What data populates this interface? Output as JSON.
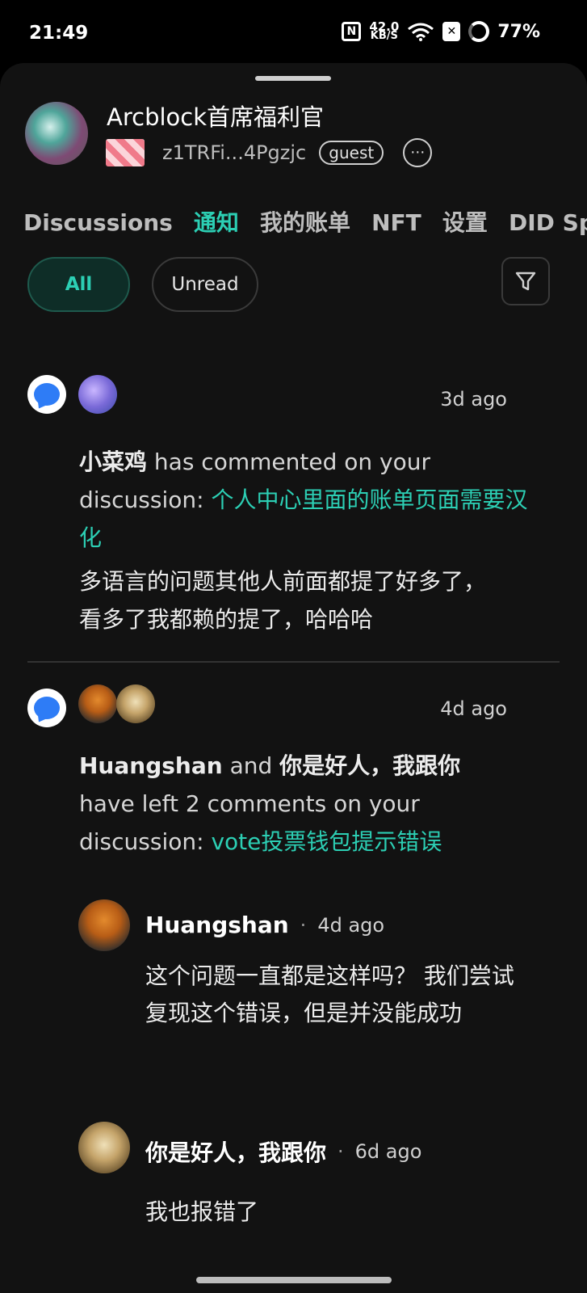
{
  "status_bar": {
    "time": "21:49",
    "speed_value": "42.0",
    "speed_unit": "KB/S",
    "battery": "77%"
  },
  "profile": {
    "name": "Arcblock首席福利官",
    "did": "z1TRFi...4Pgzjc",
    "badge": "guest",
    "more": "⋯"
  },
  "tabs": [
    {
      "label": "Discussions"
    },
    {
      "label": "通知"
    },
    {
      "label": "我的账单"
    },
    {
      "label": "NFT"
    },
    {
      "label": "设置"
    },
    {
      "label": "DID Spaces"
    }
  ],
  "filters": {
    "all": "All",
    "unread": "Unread"
  },
  "notifications": [
    {
      "time": "3d ago",
      "actor": "小菜鸡",
      "action": " has commented on your discussion: ",
      "discussion": "个人中心里面的账单页面需要汉化",
      "excerpt": "多语言的问题其他人前面都提了好多了，看多了我都赖的提了，哈哈哈"
    },
    {
      "time": "4d ago",
      "actor1": "Huangshan",
      "conj": " and ",
      "actor2": "你是好人，我跟你",
      "action": " have left 2 comments on your discussion: ",
      "discussion": "vote投票钱包提示错误",
      "comments": [
        {
          "author": "Huangshan",
          "time": "4d ago",
          "text": "这个问题一直都是这样吗？ 我们尝试复现这个错误，但是并没能成功"
        },
        {
          "author": "你是好人，我跟你",
          "time": "6d ago",
          "text": "我也报错了"
        }
      ]
    }
  ]
}
